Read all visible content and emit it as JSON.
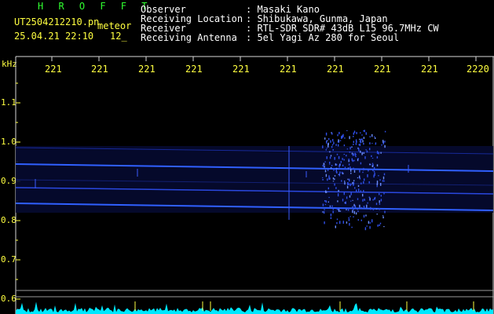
{
  "header": {
    "program": "H R O F F T",
    "filename": "UT2504212210.pn",
    "tag": "meteor",
    "datetime": "25.04.21 22:10",
    "count": "12_",
    "fields": [
      {
        "label": "Observer",
        "value": ": Masaki Kano"
      },
      {
        "label": "Receiving Location",
        "value": ": Shibukawa, Gunma, Japan"
      },
      {
        "label": "Receiver",
        "value": ": RTL-SDR SDR# 43dB L15 96.7MHz CW"
      },
      {
        "label": "Receiving Antenna",
        "value": ": 5el Yagi Az 280 for Seoul"
      }
    ]
  },
  "axes": {
    "y_unit": "kHz",
    "y_ticks": [
      "1.1",
      "1.0",
      "0.9",
      "0.8",
      "0.7",
      "0.6"
    ],
    "x_ticks": [
      "221",
      "221",
      "221",
      "221",
      "221",
      "221",
      "221",
      "221",
      "221",
      "2220"
    ]
  },
  "colors": {
    "background": "#000000",
    "signal": "#3050ff",
    "bright": "#4070ff",
    "axis_text": "#ffff40",
    "title": "#30ff30",
    "bottom_trace": "#00e8ff"
  }
}
